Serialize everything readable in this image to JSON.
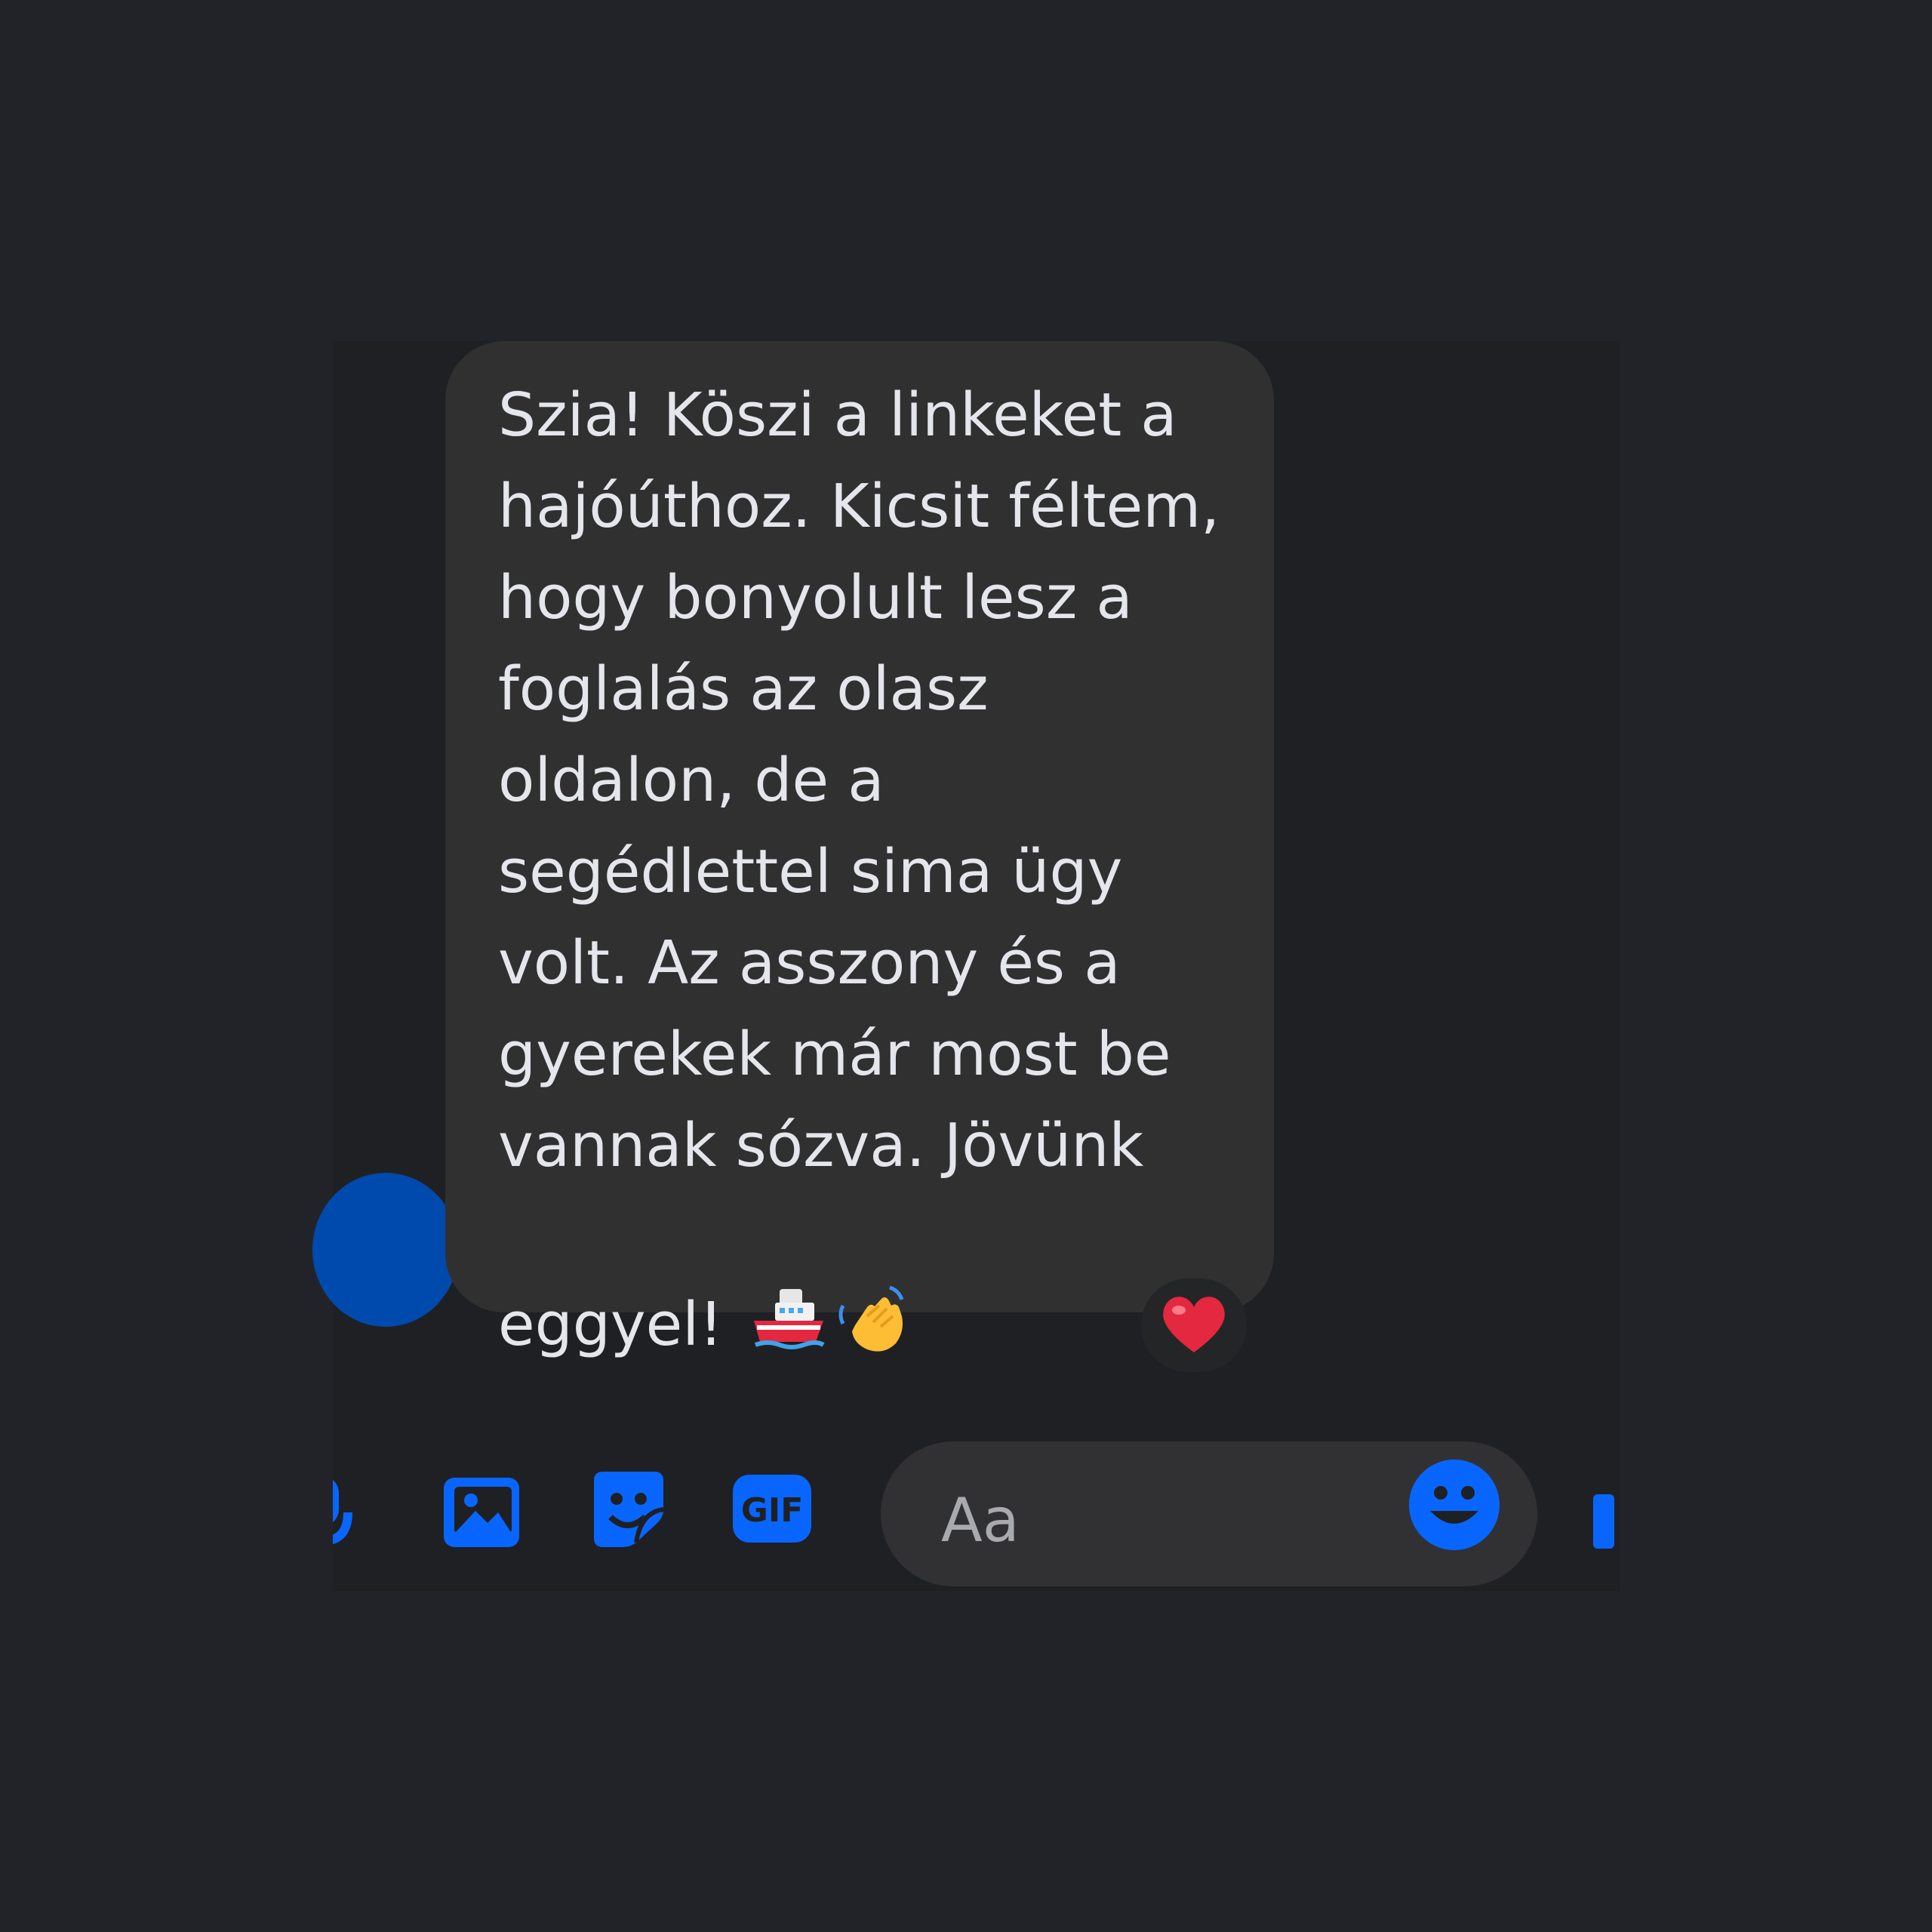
{
  "conversation": {
    "message": {
      "text": "Szia! Köszi a linkeket a\nhajóúthoz. Kicsit féltem,\nhogy bonyolult lesz a\nfoglalás az olasz\noldalon, de a\nsegédlettel sima ügy\nvolt. Az asszony és a\ngyerekek már most be\nvannak sózva. Jövünk\neggyel! ",
      "emojis": [
        "ship-emoji",
        "waving-hand-emoji"
      ],
      "reaction": "heart-emoji"
    }
  },
  "composer": {
    "placeholder": "Aa",
    "tools": [
      "microphone-icon",
      "photo-icon",
      "sticker-icon",
      "gif-icon"
    ],
    "gif_label": "GIF"
  },
  "colors": {
    "background": "#222328",
    "panel": "#1f2023",
    "bubble": "#303030",
    "text": "#e4e6eb",
    "accent": "#0866ff",
    "avatar": "#004aad",
    "heart": "#e4283f"
  }
}
